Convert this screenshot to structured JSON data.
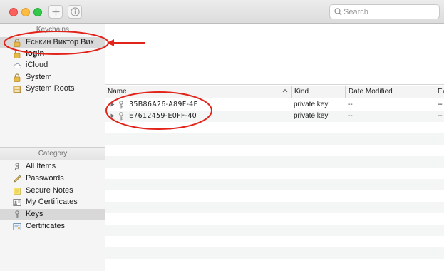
{
  "toolbar": {
    "search_placeholder": "Search",
    "icons": [
      "add-icon",
      "info-icon",
      "search-icon"
    ]
  },
  "sidebar": {
    "keychains_header": "Keychains",
    "keychains": [
      {
        "label": "Еськин Виктор Вик",
        "icon": "lock-icon",
        "selected": true,
        "bold": false
      },
      {
        "label": "login",
        "icon": "lock-icon",
        "selected": false,
        "bold": true
      },
      {
        "label": "iCloud",
        "icon": "cloud-icon",
        "selected": false,
        "bold": false
      },
      {
        "label": "System",
        "icon": "lock-icon",
        "selected": false,
        "bold": false
      },
      {
        "label": "System Roots",
        "icon": "cabinet-icon",
        "selected": false,
        "bold": false
      }
    ],
    "category_header": "Category",
    "categories": [
      {
        "label": "All Items",
        "icon": "all-items-icon",
        "selected": false
      },
      {
        "label": "Passwords",
        "icon": "pencil-icon",
        "selected": false
      },
      {
        "label": "Secure Notes",
        "icon": "note-icon",
        "selected": false
      },
      {
        "label": "My Certificates",
        "icon": "my-certificate-icon",
        "selected": false
      },
      {
        "label": "Keys",
        "icon": "key-icon",
        "selected": true
      },
      {
        "label": "Certificates",
        "icon": "certificate-icon",
        "selected": false
      }
    ]
  },
  "table": {
    "columns": [
      "Name",
      "Kind",
      "Date Modified",
      "Ex"
    ],
    "rows": [
      {
        "name": "35B86A26-A89F-4E",
        "kind": "private key",
        "date_modified": "--",
        "ex": "--"
      },
      {
        "name": "E7612459-E0FF-40",
        "kind": "private key",
        "date_modified": "--",
        "ex": "--"
      }
    ]
  },
  "colors": {
    "annotation_red": "#e2231a",
    "sidebar_bg": "#f5f5f5",
    "selection_gray": "#d8d8d8"
  }
}
